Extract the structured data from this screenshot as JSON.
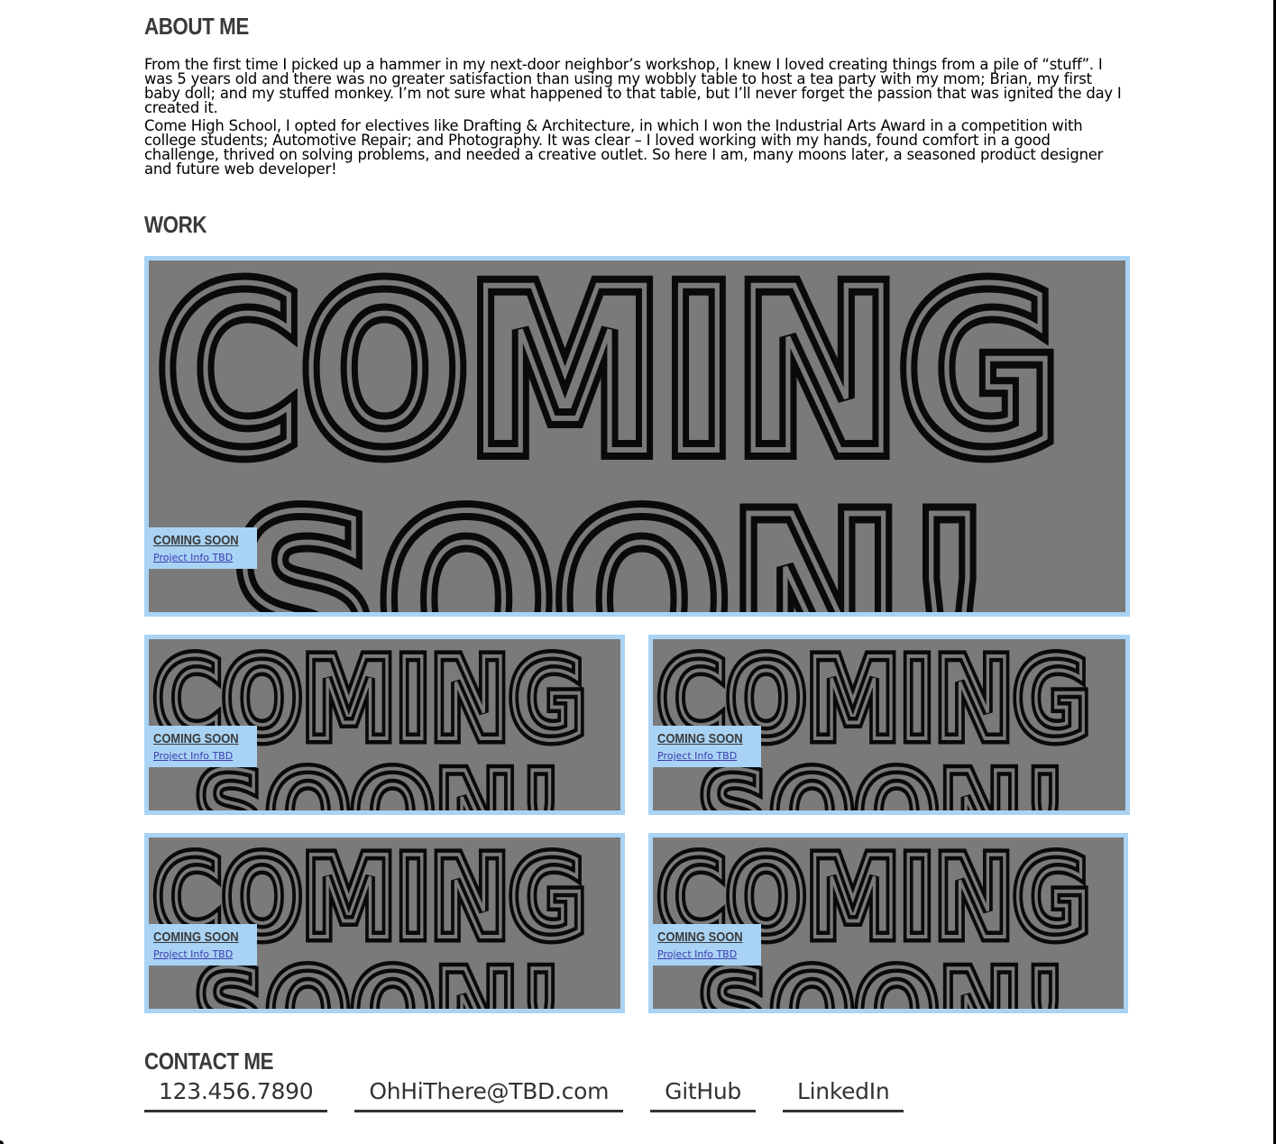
{
  "about": {
    "title": "About Me",
    "paragraph1": "From the first time I picked up a hammer in my next-door neighbor’s workshop, I knew I loved creating things from a pile of “stuff”. I was 5 years old and there was no greater satisfaction than using my wobbly table to host a tea party with my mom; Brian, my first baby doll; and my stuffed monkey. I’m not sure what happened to that table, but I’ll never forget the passion that was ignited the day I created it.",
    "paragraph2": "Come High School, I opted for electives like Drafting & Architecture, in which I won the Industrial Arts Award in a competition with college students; Automotive Repair; and Photography. It was clear – I loved working with my hands, found comfort in a good challenge, thrived on solving problems, and needed a creative outlet. So here I am, many moons later, a seasoned product designer and future web developer!"
  },
  "work": {
    "title": "Work",
    "projects": [
      {
        "title": "Coming Soon",
        "link": "Project Info TBD",
        "image_text": "COMING SOON!"
      },
      {
        "title": "Coming Soon",
        "link": "Project Info TBD",
        "image_text": "COMING SOON!"
      },
      {
        "title": "Coming Soon",
        "link": "Project Info TBD",
        "image_text": "COMING SOON!"
      },
      {
        "title": "Coming Soon",
        "link": "Project Info TBD",
        "image_text": "COMING SOON!"
      },
      {
        "title": "Coming Soon",
        "link": "Project Info TBD",
        "image_text": "COMING SOON!"
      }
    ]
  },
  "contact": {
    "title": "Contact Me",
    "phone": "123.456.7890",
    "email": "OhHiThere@TBD.com",
    "github": "GitHub",
    "linkedin": "LinkedIn"
  },
  "colors": {
    "card_border": "#a9d3f4",
    "card_image_bg": "#7a7a7a",
    "heading": "#3a3a3a",
    "link": "#3b3bb0"
  }
}
